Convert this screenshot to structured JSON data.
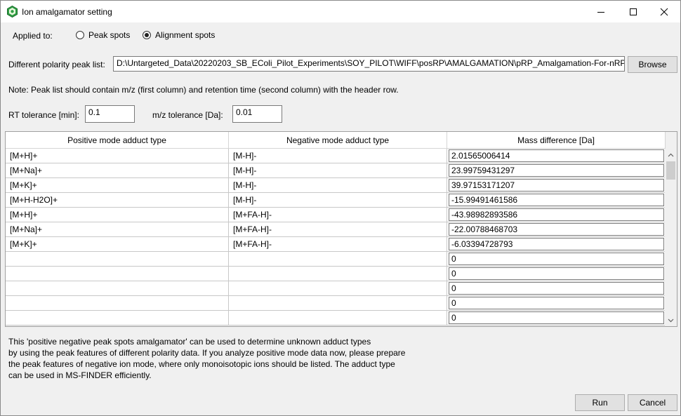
{
  "window": {
    "title": "Ion amalgamator setting"
  },
  "applied": {
    "label": "Applied to:",
    "options": [
      {
        "label": "Peak spots",
        "checked": false
      },
      {
        "label": "Alignment spots",
        "checked": true
      }
    ]
  },
  "peak_list": {
    "label": "Different polarity peak list:",
    "value": "D:\\Untargeted_Data\\20220203_SB_EColi_Pilot_Experiments\\SOY_PILOT\\WIFF\\posRP\\AMALGAMATION\\pRP_Amalgamation-For-nRP.txt",
    "browse_label": "Browse"
  },
  "note": "Note: Peak list should contain m/z (first column) and retention time (second column) with the header row.",
  "tolerance": {
    "rt_label": "RT tolerance [min]:",
    "rt_value": "0.1",
    "mz_label": "m/z tolerance [Da]:",
    "mz_value": "0.01"
  },
  "table": {
    "headers": [
      "Positive mode adduct type",
      "Negative mode adduct type",
      "Mass difference [Da]"
    ],
    "rows": [
      [
        "[M+H]+",
        "[M-H]-",
        "2.01565006414"
      ],
      [
        "[M+Na]+",
        "[M-H]-",
        "23.99759431297"
      ],
      [
        "[M+K]+",
        "[M-H]-",
        "39.97153171207"
      ],
      [
        "[M+H-H2O]+",
        "[M-H]-",
        "-15.99491461586"
      ],
      [
        "[M+H]+",
        "[M+FA-H]-",
        "-43.98982893586"
      ],
      [
        "[M+Na]+",
        "[M+FA-H]-",
        "-22.00788468703"
      ],
      [
        "[M+K]+",
        "[M+FA-H]-",
        "-6.03394728793"
      ],
      [
        "",
        "",
        "0"
      ],
      [
        "",
        "",
        "0"
      ],
      [
        "",
        "",
        "0"
      ],
      [
        "",
        "",
        "0"
      ],
      [
        "",
        "",
        "0"
      ]
    ]
  },
  "description": [
    "This 'positive negative peak spots amalgamator' can be used to determine unknown adduct types",
    "by using the peak features of different polarity data. If you analyze positive mode data now, please prepare",
    "the peak features of negative ion mode, where only monoisotopic ions should be listed. The adduct type",
    "can be used in MS-FINDER efficiently."
  ],
  "buttons": {
    "run": "Run",
    "cancel": "Cancel"
  },
  "icons": {
    "app": "molecule-icon",
    "minimize": "minimize-icon",
    "maximize": "maximize-icon",
    "close": "close-icon"
  }
}
